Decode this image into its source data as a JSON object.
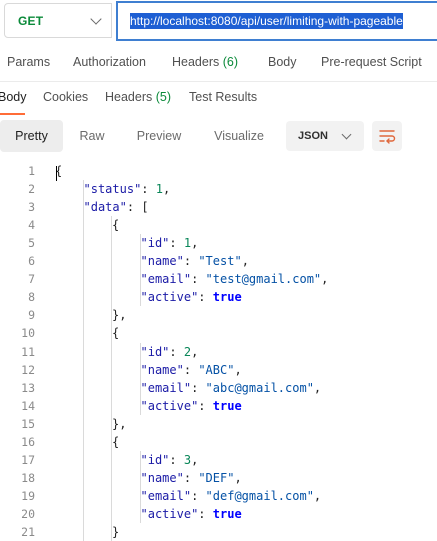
{
  "request": {
    "method": "GET",
    "url": "http://localhost:8080/api/user/limiting-with-pageable"
  },
  "request_tabs": [
    {
      "label": "Params"
    },
    {
      "label": "Authorization"
    },
    {
      "label": "Headers",
      "count": "(6)"
    },
    {
      "label": "Body"
    },
    {
      "label": "Pre-request Script"
    }
  ],
  "response_tabs": [
    {
      "label": "Body"
    },
    {
      "label": "Cookies"
    },
    {
      "label": "Headers",
      "count": "(5)"
    },
    {
      "label": "Test Results"
    }
  ],
  "view_modes": [
    "Pretty",
    "Raw",
    "Preview",
    "Visualize"
  ],
  "active_view_mode": "Pretty",
  "format_select": "JSON",
  "icons": [
    "chevron-down-icon",
    "wrap-lines-icon"
  ],
  "colors": {
    "method": "#0b8a3a",
    "url_highlight": "#1e5fd3",
    "active_tab_underline": "#ff6c37"
  },
  "code_lines": [
    "1",
    "2",
    "3",
    "4",
    "5",
    "6",
    "7",
    "8",
    "9",
    "10",
    "11",
    "12",
    "13",
    "14",
    "15",
    "16",
    "17",
    "18",
    "19",
    "20",
    "21"
  ],
  "response_json": {
    "open": "{",
    "status_key": "\"status\"",
    "status_val": "1",
    "data_key": "\"data\"",
    "data_open": "[",
    "items": [
      {
        "id": "1",
        "name": "\"Test\"",
        "email": "\"test@gmail.com\"",
        "active": "true"
      },
      {
        "id": "2",
        "name": "\"ABC\"",
        "email": "\"abc@gmail.com\"",
        "active": "true"
      },
      {
        "id": "3",
        "name": "\"DEF\"",
        "email": "\"def@gmail.com\"",
        "active": "true"
      }
    ],
    "id_key": "\"id\"",
    "name_key": "\"name\"",
    "email_key": "\"email\"",
    "active_key": "\"active\""
  }
}
